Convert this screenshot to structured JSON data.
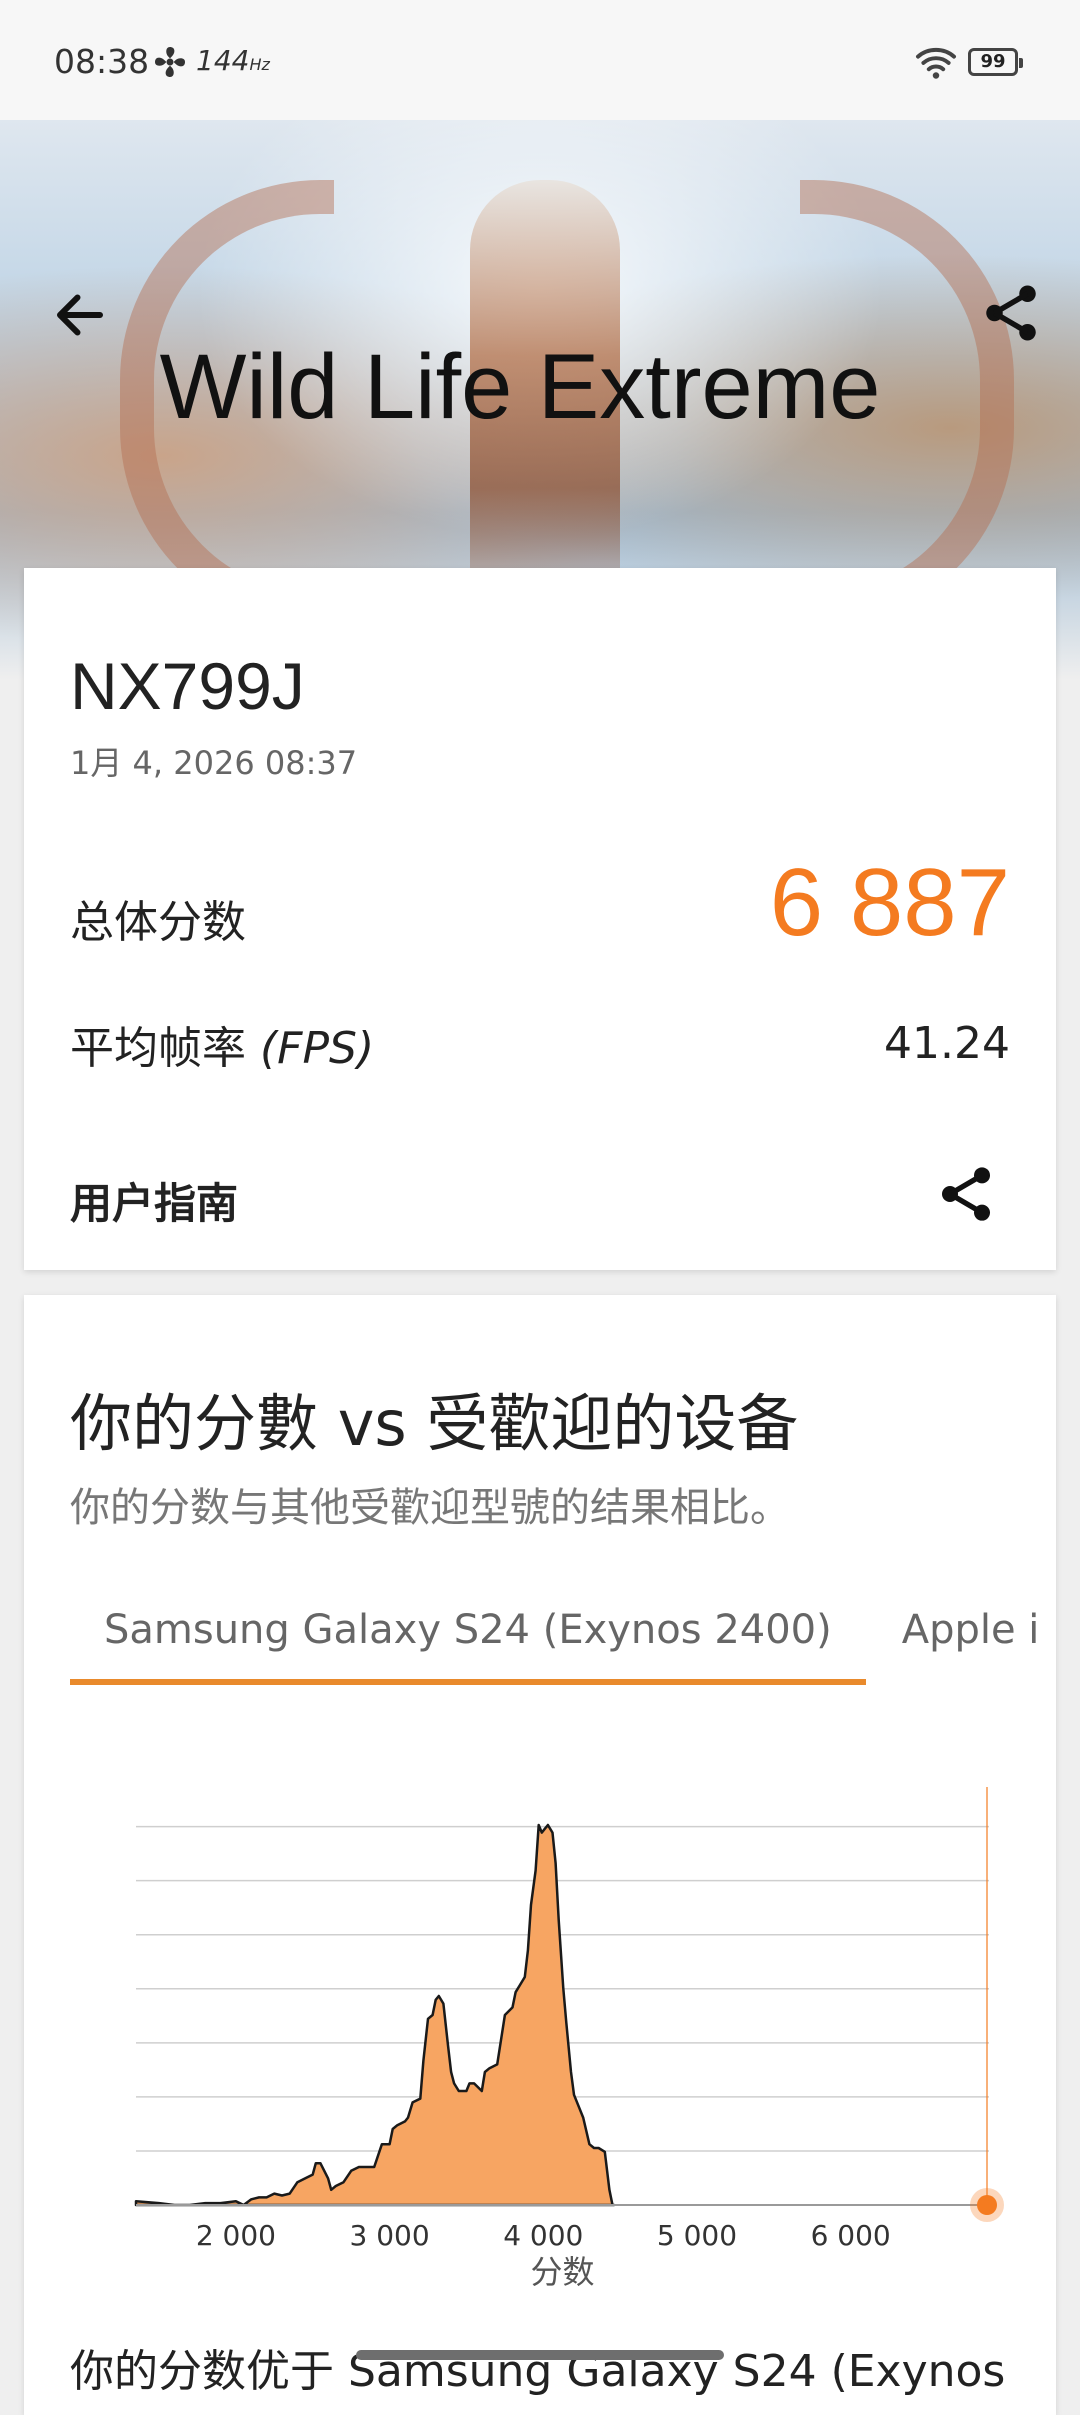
{
  "status_bar": {
    "time": "08:38",
    "refresh_rate": "144",
    "refresh_unit": "Hz",
    "battery": "99"
  },
  "hero": {
    "title": "Wild Life Extreme"
  },
  "result": {
    "device": "NX799J",
    "datetime": "1月 4, 2026 08:37",
    "overall_label": "总体分数",
    "overall_score": "6 887",
    "fps_label": "平均帧率",
    "fps_unit": "(FPS)",
    "fps_value": "41.24",
    "guide_label": "用户指南"
  },
  "comparison": {
    "title": "你的分數 vs 受歡迎的设备",
    "subtitle": "你的分数与其他受歡迎型號的结果相比。",
    "tabs": [
      "Samsung Galaxy S24 (Exynos 2400)",
      "Apple iPhc"
    ],
    "active_tab": 0,
    "beats_text": "你的分数优于 Samsung Galaxy S24 (Exynos"
  },
  "chart_data": {
    "type": "area",
    "xlabel": "分数",
    "x_ticks": [
      "2 000",
      "3 000",
      "4 000",
      "5 000",
      "6 000"
    ],
    "x_tick_values": [
      2000,
      3000,
      4000,
      5000,
      6000
    ],
    "xlim": [
      1350,
      6900
    ],
    "ylim": [
      0,
      1.0
    ],
    "fill_color": "#f7a562",
    "stroke_color": "#1a1a1a",
    "marker_color": "#f47b20",
    "your_score": 6887,
    "x": [
      1350,
      1500,
      1600,
      1700,
      1800,
      1900,
      2000,
      2050,
      2100,
      2150,
      2200,
      2250,
      2300,
      2350,
      2400,
      2450,
      2500,
      2520,
      2550,
      2600,
      2620,
      2650,
      2700,
      2750,
      2800,
      2850,
      2900,
      2950,
      2980,
      3000,
      3020,
      3050,
      3100,
      3120,
      3150,
      3200,
      3220,
      3250,
      3280,
      3300,
      3320,
      3350,
      3380,
      3400,
      3420,
      3450,
      3480,
      3500,
      3520,
      3550,
      3600,
      3620,
      3650,
      3700,
      3750,
      3800,
      3820,
      3850,
      3880,
      3900,
      3920,
      3950,
      3970,
      3990,
      4010,
      4030,
      4060,
      4080,
      4100,
      4130,
      4150,
      4180,
      4200,
      4230,
      4260,
      4300,
      4330,
      4360,
      4400,
      4430,
      4450,
      4460
    ],
    "y": [
      0.01,
      0.005,
      0.0,
      0.0,
      0.005,
      0.005,
      0.01,
      0.0,
      0.015,
      0.02,
      0.02,
      0.03,
      0.025,
      0.03,
      0.06,
      0.07,
      0.08,
      0.11,
      0.11,
      0.07,
      0.04,
      0.05,
      0.06,
      0.09,
      0.1,
      0.1,
      0.1,
      0.16,
      0.16,
      0.16,
      0.2,
      0.21,
      0.22,
      0.23,
      0.27,
      0.28,
      0.38,
      0.49,
      0.5,
      0.54,
      0.55,
      0.53,
      0.42,
      0.35,
      0.32,
      0.3,
      0.3,
      0.3,
      0.32,
      0.32,
      0.3,
      0.35,
      0.36,
      0.37,
      0.5,
      0.52,
      0.56,
      0.58,
      0.6,
      0.67,
      0.79,
      0.88,
      1.0,
      0.98,
      0.99,
      1.0,
      0.98,
      0.9,
      0.75,
      0.57,
      0.48,
      0.35,
      0.29,
      0.26,
      0.23,
      0.16,
      0.15,
      0.15,
      0.14,
      0.04,
      0.0,
      0.0
    ]
  }
}
